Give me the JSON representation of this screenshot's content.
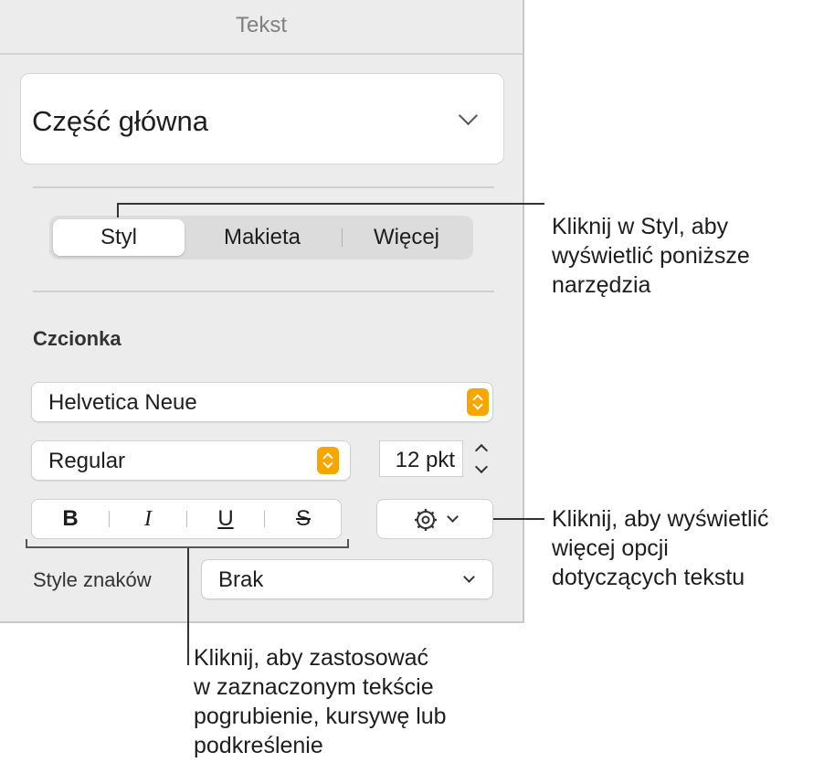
{
  "panel": {
    "title": "Tekst",
    "paragraph_style": "Część główna",
    "tabs": [
      {
        "label": "Styl",
        "active": true
      },
      {
        "label": "Makieta",
        "active": false
      },
      {
        "label": "Więcej",
        "active": false
      }
    ],
    "font_section_label": "Czcionka",
    "font_family": "Helvetica Neue",
    "font_style": "Regular",
    "font_size": "12 pkt",
    "format_buttons": {
      "bold": "B",
      "italic": "I",
      "underline": "U",
      "strikethrough": "S"
    },
    "char_style_label": "Style znaków",
    "char_style_value": "Brak",
    "accent_color": "#f7a600"
  },
  "callouts": {
    "style_tab": [
      "Kliknij w Styl, aby",
      "wyświetlić poniższe",
      "narzędzia"
    ],
    "more_options": [
      "Kliknij, aby wyświetlić",
      "więcej opcji",
      "dotyczących tekstu"
    ],
    "format_buttons": [
      "Kliknij, aby zastosować",
      "w zaznaczonym tekście",
      "pogrubienie, kursywę lub",
      "podkreślenie"
    ]
  }
}
